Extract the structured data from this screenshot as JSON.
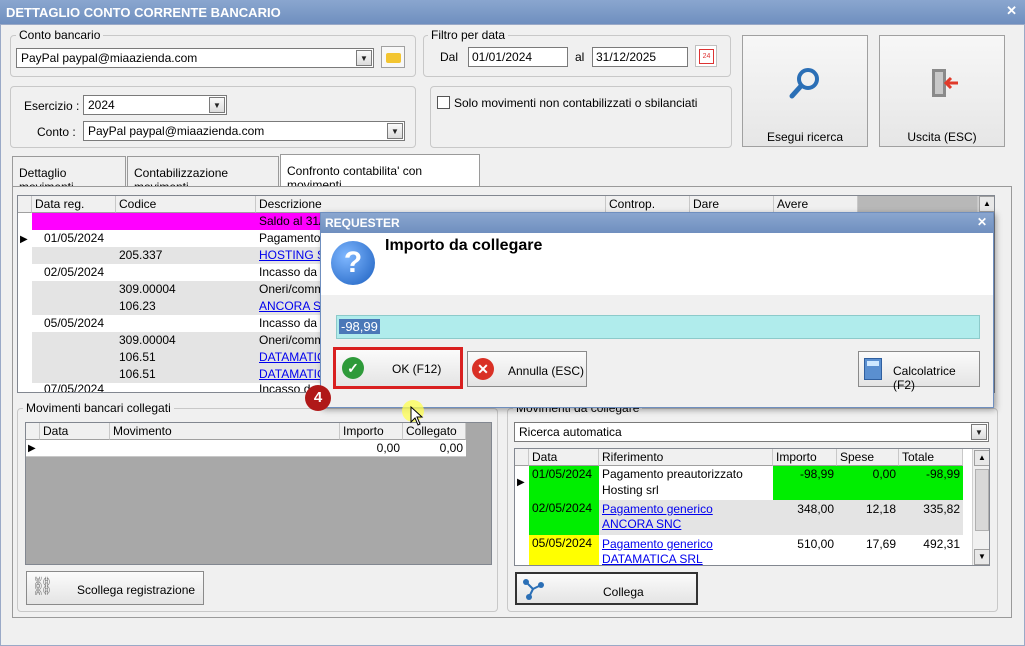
{
  "window": {
    "title": "DETTAGLIO CONTO CORRENTE BANCARIO"
  },
  "conto_bancario": {
    "label": "Conto bancario",
    "value": "PayPal paypal@miaazienda.com"
  },
  "filtro": {
    "label": "Filtro per data",
    "dal_label": "Dal",
    "dal": "01/01/2024",
    "al_label": "al",
    "al": "31/12/2025"
  },
  "esercizio": {
    "label": "Esercizio :",
    "value": "2024",
    "conto_label": "Conto :",
    "conto_value": "PayPal paypal@miaazienda.com"
  },
  "solo_movimenti": "Solo movimenti non contabilizzati o sbilanciati",
  "buttons": {
    "esegui": "Esegui ricerca",
    "uscita": "Uscita (ESC)",
    "scollega": "Scollega registrazione",
    "collega": "Collega"
  },
  "tabs": [
    "Dettaglio movimenti",
    "Contabilizzazione movimenti",
    "Confronto contabilita' con movimenti"
  ],
  "main_grid": {
    "headers": [
      "Data reg.",
      "Codice",
      "Descrizione",
      "Controp.",
      "Dare",
      "Avere"
    ],
    "rows": [
      {
        "date": "",
        "code": "",
        "desc": "Saldo al 31/1"
      },
      {
        "date": "01/05/2024",
        "code": "",
        "desc": "Pagamento a"
      },
      {
        "date": "",
        "code": "205.337",
        "desc": "HOSTING SR"
      },
      {
        "date": "02/05/2024",
        "code": "",
        "desc": "Incasso da c"
      },
      {
        "date": "",
        "code": "309.00004",
        "desc": "Oneri/commi"
      },
      {
        "date": "",
        "code": "106.23",
        "desc": "ANCORA SNC"
      },
      {
        "date": "05/05/2024",
        "code": "",
        "desc": "Incasso da c"
      },
      {
        "date": "",
        "code": "309.00004",
        "desc": "Oneri/commi"
      },
      {
        "date": "",
        "code": "106.51",
        "desc": "DATAMATIC"
      },
      {
        "date": "",
        "code": "106.51",
        "desc": "DATAMATIC"
      },
      {
        "date": "07/05/2024",
        "code": "",
        "desc": "Incasso d"
      }
    ]
  },
  "collegati": {
    "label": "Movimenti bancari collegati",
    "headers": [
      "Data",
      "Movimento",
      "Importo",
      "Collegato"
    ],
    "row": {
      "importo": "0,00",
      "collegato": "0,00"
    }
  },
  "da_collegare": {
    "label": "Movimenti da collegare",
    "combo": "Ricerca automatica",
    "headers": [
      "Data",
      "Riferimento",
      "Importo",
      "Spese",
      "Totale"
    ],
    "rows": [
      {
        "date": "01/05/2024",
        "ref1": "Pagamento preautorizzato",
        "ref2": "Hosting srl",
        "importo": "-98,99",
        "spese": "0,00",
        "totale": "-98,99"
      },
      {
        "date": "02/05/2024",
        "ref1": "Pagamento generico",
        "ref2": "ANCORA SNC",
        "importo": "348,00",
        "spese": "12,18",
        "totale": "335,82"
      },
      {
        "date": "05/05/2024",
        "ref1": "Pagamento generico",
        "ref2": "DATAMATICA SRL",
        "importo": "510,00",
        "spese": "17,69",
        "totale": "492,31"
      }
    ]
  },
  "dialog": {
    "title": "REQUESTER",
    "heading": "Importo da collegare",
    "value": "-98,99",
    "ok": "OK (F12)",
    "annulla": "Annulla (ESC)",
    "calcolatrice": "Calcolatrice (F2)"
  },
  "step_badge": "4",
  "colors": {
    "magenta": "#ff00ff",
    "green": "#00ee00",
    "yellow": "#ffff00",
    "highlight_red": "#d92020",
    "input_cyan": "#b0ecec"
  }
}
